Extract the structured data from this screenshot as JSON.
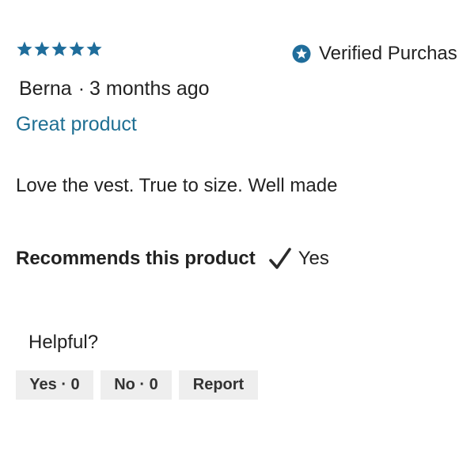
{
  "review": {
    "rating": 5,
    "rating_max": 5,
    "star_color": "#1f6d9b",
    "verified": {
      "icon": "star-badge-icon",
      "label": "Verified Purchas"
    },
    "author": "Berna",
    "separator": "·",
    "time_ago": "3 months ago",
    "title": "Great product",
    "title_color": "#1f6f93",
    "body": "Love the vest. True to size. Well made",
    "recommends": {
      "label": "Recommends this product",
      "icon": "checkmark-icon",
      "value": "Yes"
    },
    "helpful": {
      "label": "Helpful?",
      "yes_label": "Yes · 0",
      "no_label": "No · 0",
      "report_label": "Report"
    }
  }
}
